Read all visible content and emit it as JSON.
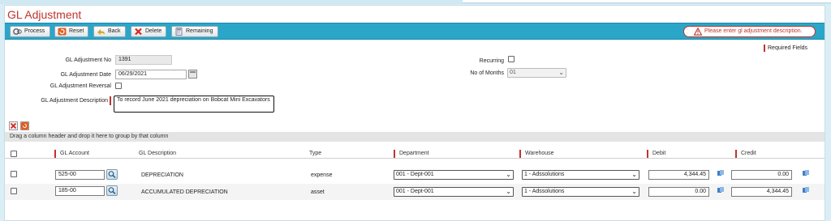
{
  "page": {
    "title": "GL Adjustment"
  },
  "toolbar": {
    "buttons": [
      {
        "label": "Process",
        "icon": "process-icon"
      },
      {
        "label": "Reset",
        "icon": "reset-icon"
      },
      {
        "label": "Back",
        "icon": "back-arrow-icon"
      },
      {
        "label": "Delete",
        "icon": "delete-x-icon"
      },
      {
        "label": "Remaining",
        "icon": "remaining-calc-icon"
      }
    ],
    "error_message": "Please enter gl adjustment description."
  },
  "required_fields_label": "Required Fields",
  "form": {
    "adjustment_no_label": "GL Adjustment No",
    "adjustment_no_value": "1391",
    "adjustment_date_label": "GL Adjustment Date",
    "adjustment_date_value": "06/29/2021",
    "reversal_label": "GL Adjustment Reversal",
    "reversal_checked": false,
    "description_label": "GL Adjustment Description",
    "description_value": "To record June 2021 depreciation on Bobcat Mini Excavators",
    "recurring_label": "Recurring",
    "recurring_checked": false,
    "months_label": "No of Months",
    "months_value": "01"
  },
  "grid": {
    "group_hint": "Drag a column header and drop it here to group by that column",
    "columns": {
      "account": "GL Account",
      "description": "GL Description",
      "type": "Type",
      "department": "Department",
      "warehouse": "Warehouse",
      "debit": "Debit",
      "credit": "Credit"
    },
    "rows": [
      {
        "account": "525-00",
        "description": "DEPRECIATION",
        "type": "expense",
        "department": "001 - Dept-001",
        "warehouse": "1 - Adssolutions",
        "debit": "4,344.45",
        "credit": "0.00"
      },
      {
        "account": "185-00",
        "description": "ACCUMULATED DEPRECIATION",
        "type": "asset",
        "department": "001 - Dept-001",
        "warehouse": "1 - Adssolutions",
        "debit": "0.00",
        "credit": "4,344.45"
      }
    ]
  },
  "colors": {
    "title": "#c0342b",
    "toolbar": "#2aa6c9",
    "required_marker": "#c0342b",
    "background": "#d9eef5"
  }
}
